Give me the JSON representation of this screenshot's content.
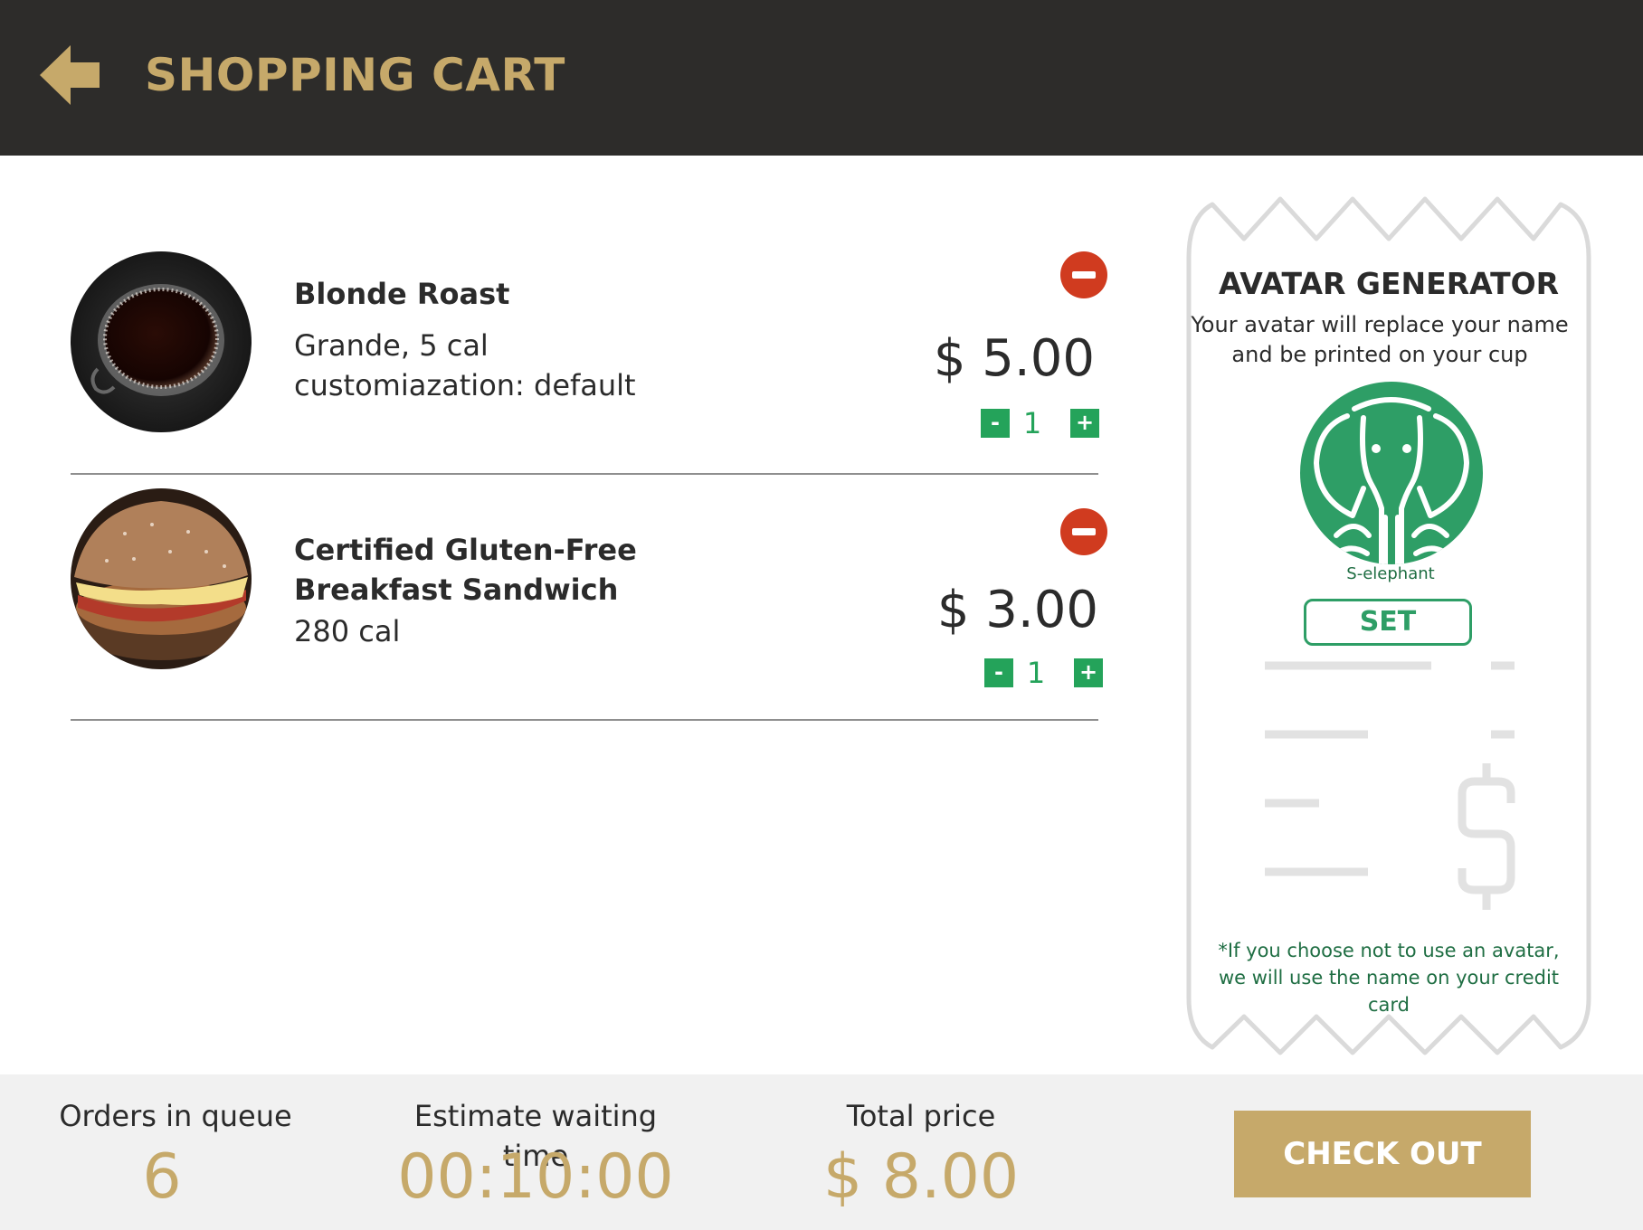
{
  "header": {
    "title": "SHOPPING CART",
    "back_icon": "back-arrow-icon"
  },
  "cart": {
    "items": [
      {
        "name": "Blonde Roast",
        "details": [
          "Grande, 5 cal",
          "customiazation: default"
        ],
        "price": "$ 5.00",
        "quantity": "1",
        "minus_label": "-",
        "plus_label": "+"
      },
      {
        "name": "Certified Gluten-Free Breakfast Sandwich",
        "details": [
          "280 cal"
        ],
        "price": "$ 3.00",
        "quantity": "1",
        "minus_label": "-",
        "plus_label": "+"
      }
    ]
  },
  "avatar": {
    "title": "AVATAR GENERATOR",
    "description": "Your avatar will replace your name and be printed on your cup",
    "avatar_name": "S-elephant",
    "set_label": "SET",
    "note": "*If you choose not to use an avatar, we will use the name on your credit card"
  },
  "footer": {
    "queue_label": "Orders in queue",
    "queue_value": "6",
    "wait_label": "Estimate waiting time",
    "wait_value": "00:10:00",
    "total_label": "Total price",
    "total_value": "$ 8.00",
    "checkout_label": "CHECK OUT"
  },
  "colors": {
    "header_bg": "#2d2c2a",
    "gold": "#c6a96a",
    "green": "#24a35a",
    "avatar_green": "#2e9e66",
    "remove_red": "#d03b1f",
    "footer_bg": "#f1f1f1"
  }
}
